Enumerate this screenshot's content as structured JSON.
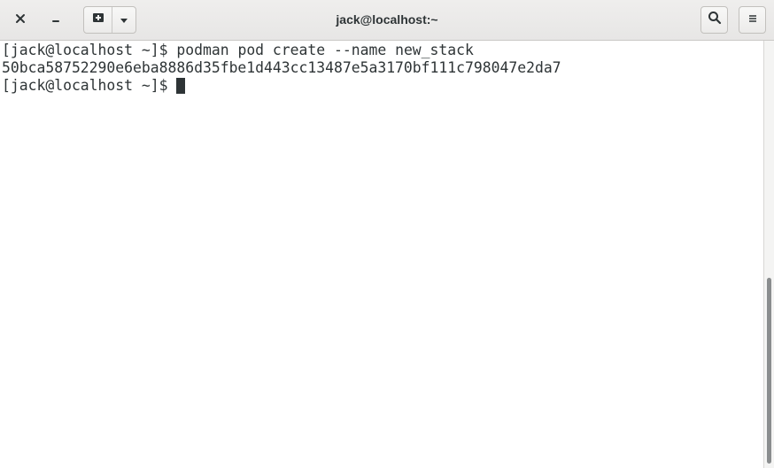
{
  "window": {
    "title": "jack@localhost:~"
  },
  "icons": {
    "close": "close-icon",
    "minimize": "minimize-icon",
    "new_tab": "new-tab-icon",
    "dropdown": "chevron-down-icon",
    "search": "search-icon",
    "menu": "hamburger-menu-icon"
  },
  "terminal": {
    "lines": [
      {
        "prompt": "[jack@localhost ~]$ ",
        "text": "podman pod create --name new_stack"
      },
      {
        "prompt": "",
        "text": "50bca58752290e6eba8886d35fbe1d443cc13487e5a3170bf111c798047e2da7"
      },
      {
        "prompt": "[jack@localhost ~]$ ",
        "text": ""
      }
    ]
  },
  "colors": {
    "text": "#2e3436",
    "background": "#ffffff",
    "titlebar": "#e8e7e6"
  }
}
